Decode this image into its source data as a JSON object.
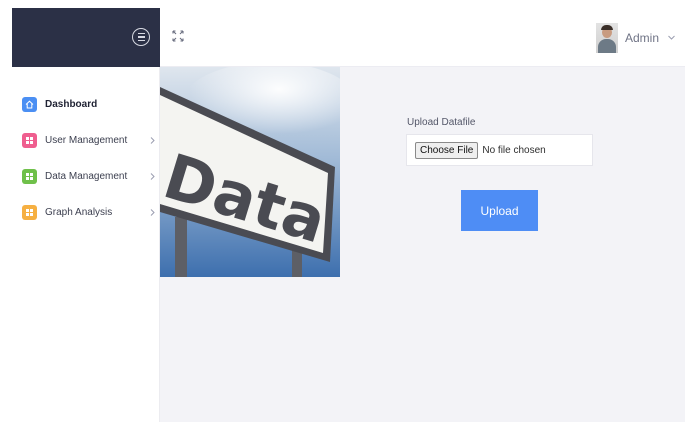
{
  "topbar": {
    "user_name": "Admin"
  },
  "sidebar": {
    "items": [
      {
        "label": "Dashboard",
        "icon": "home-icon",
        "color": "#4b8ff3",
        "active": true
      },
      {
        "label": "User Management",
        "icon": "grid-icon",
        "color": "#ef5e8f"
      },
      {
        "label": "Data Management",
        "icon": "grid-icon",
        "color": "#6fc04a"
      },
      {
        "label": "Graph Analysis",
        "icon": "grid-icon",
        "color": "#f6b042"
      }
    ]
  },
  "hero": {
    "sign_text": "Data"
  },
  "upload": {
    "label": "Upload Datafile",
    "choose_label": "Choose File",
    "file_status": "No file chosen",
    "button_label": "Upload"
  },
  "colors": {
    "brand_bg": "#2b3046",
    "accent": "#4e8df5",
    "content_bg": "#f3f3f7"
  }
}
